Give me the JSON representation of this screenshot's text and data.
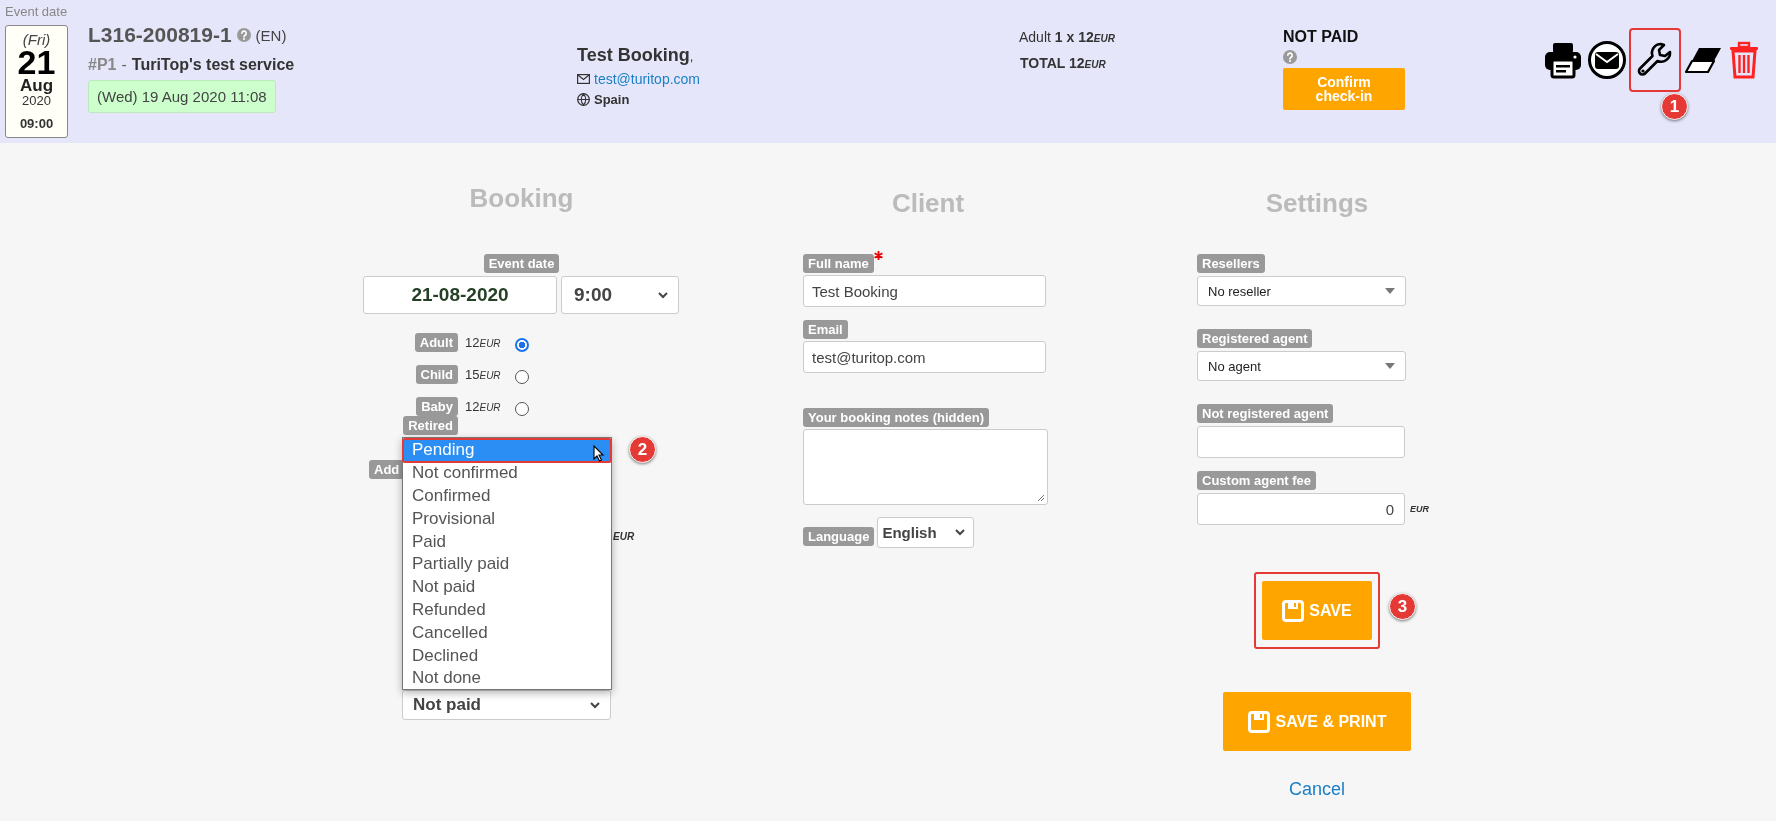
{
  "header": {
    "event_date_label": "Event date",
    "date": {
      "weekday": "(Fri)",
      "day": "21",
      "month": "Aug",
      "year": "2020",
      "time": "09:00"
    },
    "booking_code": "L316-200819-1",
    "language": "(EN)",
    "product_code": "#P1",
    "separator": "-",
    "service": "TuriTop's test service",
    "created": "(Wed) 19 Aug 2020 11:08",
    "client": {
      "name": "Test Booking",
      "trailing": ",",
      "email": "test@turitop.com",
      "country": "Spain"
    },
    "price": {
      "label": "Adult",
      "amount": "1 x 12",
      "currency": "EUR",
      "total_label": "TOTAL",
      "total": "12",
      "total_currency": "EUR"
    },
    "payment_status": "NOT PAID",
    "checkin_button": "Confirm check-in",
    "actions": [
      {
        "kind": "print"
      },
      {
        "kind": "mail"
      },
      {
        "kind": "wrench",
        "annotation": "1"
      },
      {
        "kind": "eraser"
      },
      {
        "kind": "trash"
      }
    ]
  },
  "booking": {
    "title": "Booking",
    "event_date_label": "Event date",
    "date_value": "21-08-2020",
    "time_value": "9:00",
    "rates": [
      {
        "label": "Adult",
        "price": "12",
        "currency": "EUR",
        "selected": true
      },
      {
        "label": "Child",
        "price": "15",
        "currency": "EUR",
        "selected": false
      },
      {
        "label": "Baby",
        "price": "12",
        "currency": "EUR",
        "selected": false
      },
      {
        "label": "Retired"
      }
    ],
    "covered_label": "Add",
    "covered_unit": "EUR",
    "status_options": [
      {
        "label": "Pending",
        "selected": true,
        "annotation": "2"
      },
      {
        "label": "Not confirmed",
        "selected": false
      },
      {
        "label": "Confirmed",
        "selected": false
      },
      {
        "label": "Provisional",
        "selected": false
      },
      {
        "label": "Paid",
        "selected": false
      },
      {
        "label": "Partially paid",
        "selected": false
      },
      {
        "label": "Not paid",
        "selected": false
      },
      {
        "label": "Refunded",
        "selected": false
      },
      {
        "label": "Cancelled",
        "selected": false
      },
      {
        "label": "Declined",
        "selected": false
      },
      {
        "label": "Not done",
        "selected": false
      }
    ],
    "status_value": "Not paid"
  },
  "client": {
    "title": "Client",
    "fields": [
      {
        "kind": "text",
        "label": "Full name",
        "required": true,
        "value": "Test Booking"
      },
      {
        "kind": "text",
        "label": "Email",
        "required": false,
        "value": "test@turitop.com"
      },
      {
        "kind": "textarea",
        "label": "Your booking notes (hidden)",
        "required": false
      },
      {
        "kind": "select",
        "label": "Language",
        "required": false,
        "value": "English"
      }
    ]
  },
  "settings": {
    "title": "Settings",
    "fields": [
      {
        "kind": "dropdown",
        "label": "Resellers",
        "value": "No reseller"
      },
      {
        "kind": "dropdown",
        "label": "Registered agent",
        "value": "No agent"
      },
      {
        "kind": "text",
        "label": "Not registered agent"
      },
      {
        "kind": "number",
        "label": "Custom agent fee",
        "value": "0",
        "unit": "EUR"
      }
    ],
    "save_button": {
      "label": "SAVE",
      "annotation": "3"
    },
    "save_print_button": {
      "label": "SAVE & PRINT"
    },
    "cancel_link": "Cancel"
  }
}
